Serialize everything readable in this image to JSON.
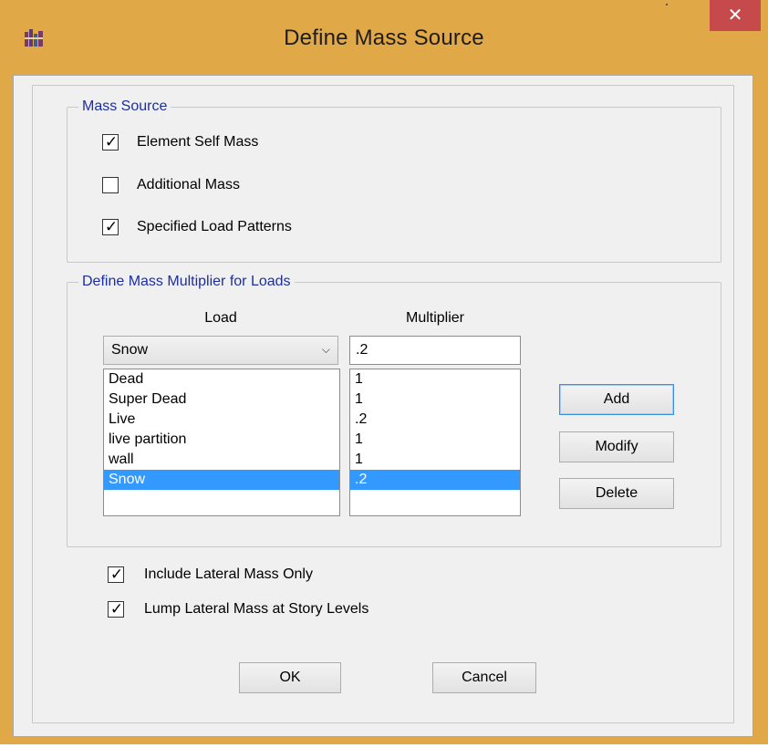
{
  "window": {
    "title": "Define Mass Source",
    "close_glyph": "✕"
  },
  "mass_source": {
    "legend": "Mass Source",
    "options": [
      {
        "label": "Element Self Mass",
        "checked": true
      },
      {
        "label": "Additional Mass",
        "checked": false
      },
      {
        "label": "Specified Load Patterns",
        "checked": true
      }
    ]
  },
  "multiplier_group": {
    "legend": "Define Mass Multiplier for Loads",
    "load_header": "Load",
    "multiplier_header": "Multiplier",
    "selected_load": "Snow",
    "multiplier_value": ".2",
    "loads": [
      "Dead",
      "Super Dead",
      "Live",
      "live partition",
      "wall",
      "Snow"
    ],
    "multipliers": [
      "1",
      "1",
      ".2",
      "1",
      "1",
      ".2"
    ],
    "selected_index": 5,
    "buttons": {
      "add": "Add",
      "modify": "Modify",
      "delete": "Delete"
    }
  },
  "options": [
    {
      "label": "Include Lateral Mass Only",
      "checked": true
    },
    {
      "label": "Lump Lateral Mass at Story Levels",
      "checked": true
    }
  ],
  "footer": {
    "ok": "OK",
    "cancel": "Cancel"
  },
  "colors": {
    "selection": "#3399ff",
    "legend_text": "#1c2fa0",
    "close_button": "#c6494c",
    "frame": "#e1a848"
  }
}
